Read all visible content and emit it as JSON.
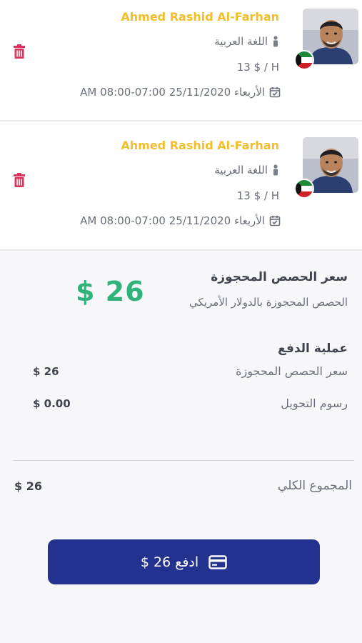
{
  "bookings": [
    {
      "teacher_name": "Ahmed Rashid Al-Farhan",
      "language": "اللغة العربية",
      "rate": "13 $ / H",
      "date": "الأربعاء 25/11/2020 07:00-08:00 AM",
      "flag": "kuwait-flag"
    },
    {
      "teacher_name": "Ahmed Rashid Al-Farhan",
      "language": "اللغة العربية",
      "rate": "13 $ / H",
      "date": "الأربعاء 25/11/2020 07:00-08:00 AM",
      "flag": "kuwait-flag"
    }
  ],
  "summary": {
    "booked_title": "سعر الحصص المحجوزة",
    "booked_subtitle": "الحصص المحجوزة بالدولار الأمريكي",
    "big_price": "$ 26"
  },
  "payment": {
    "title": "عملية الدفع",
    "rows": [
      {
        "label": "سعر الحصص المحجوزة",
        "value": "$ 26"
      },
      {
        "label": "رسوم التحويل",
        "value": "$ 0.00"
      }
    ],
    "total_label": "المجموع الكلي",
    "total_value": "$ 26"
  },
  "pay_button": {
    "label": "ادفع 26 $",
    "icon": "credit-card-icon"
  },
  "colors": {
    "name": "#f3be2a",
    "price": "#2fb37a",
    "delete": "#d9345d",
    "button": "#23318f"
  }
}
